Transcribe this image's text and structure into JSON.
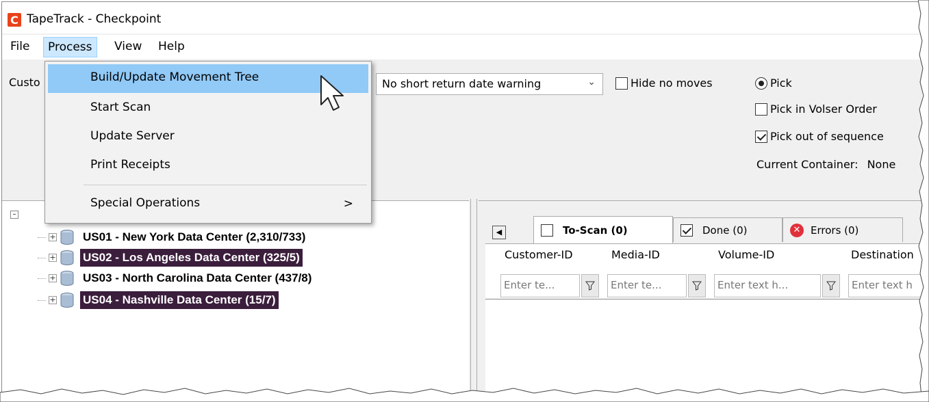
{
  "window": {
    "title": "TapeTrack - Checkpoint",
    "app_icon_letter": "C"
  },
  "menubar": {
    "items": [
      "File",
      "Process",
      "View",
      "Help"
    ]
  },
  "process_menu": {
    "items": [
      {
        "label": "Build/Update Movement Tree"
      },
      {
        "label": "Start Scan"
      },
      {
        "label": "Update Server"
      },
      {
        "label": "Print Receipts"
      },
      {
        "label": "Special Operations",
        "submenu_arrow": ">"
      }
    ]
  },
  "toolbar": {
    "customer_label_partial": "Custo",
    "return_warning_select": "No short return date warning",
    "hide_no_moves_label": "Hide no moves",
    "pick_label": "Pick",
    "pick_volser_label": "Pick in Volser Order",
    "pick_out_of_sequence_label": "Pick out of sequence",
    "current_container_label": "Current Container:",
    "current_container_value": "None"
  },
  "tree": {
    "nodes": [
      {
        "label": "US01 - New York Data Center (2,310/733)",
        "selected": false
      },
      {
        "label": "US02 - Los Angeles Data Center (325/5)",
        "selected": true
      },
      {
        "label": "US03 - North Carolina Data Center (437/8)",
        "selected": false
      },
      {
        "label": "US04 - Nashville Data Center (15/7)",
        "selected": true
      }
    ]
  },
  "tabs": [
    {
      "label": "To-Scan (0)"
    },
    {
      "label": "Done (0)"
    },
    {
      "label": "Errors (0)"
    }
  ],
  "grid": {
    "columns": [
      "Customer-ID",
      "Media-ID",
      "Volume-ID",
      "Destination"
    ],
    "filter_placeholders": [
      "Enter te...",
      "Enter te...",
      "Enter text h...",
      "Enter text h"
    ]
  },
  "colors": {
    "selected_node_bg": "#3b1d3c",
    "menu_hover": "#91c9f7",
    "app_icon": "#e8431a",
    "error_icon": "#e0313b"
  }
}
